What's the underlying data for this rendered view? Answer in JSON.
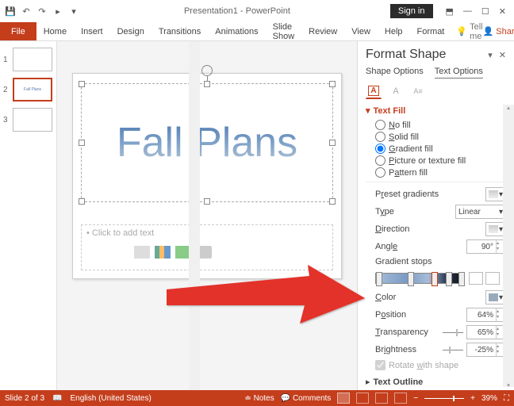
{
  "title": "Presentation1 - PowerPoint",
  "qat": {
    "save": "💾",
    "undo": "↶",
    "redo": "↷",
    "start": "▸"
  },
  "signin": "Sign in",
  "win": {
    "min": "—",
    "max": "☐",
    "close": "✕",
    "ropt": "⬒"
  },
  "tabs": {
    "file": "File",
    "home": "Home",
    "insert": "Insert",
    "design": "Design",
    "transitions": "Transitions",
    "animations": "Animations",
    "slideshow": "Slide Show",
    "review": "Review",
    "view": "View",
    "help": "Help",
    "format": "Format"
  },
  "tellme": "Tell me",
  "share": "Share",
  "thumbs": [
    {
      "n": "1",
      "txt": ""
    },
    {
      "n": "2",
      "txt": "Fall Plans"
    },
    {
      "n": "3",
      "txt": ""
    }
  ],
  "slide": {
    "title": "Fall Plans",
    "content_placeholder": "• Click to add text"
  },
  "panel": {
    "title": "Format Shape",
    "opt_shape": "Shape Options",
    "opt_text": "Text Options",
    "sec_textfill": "Text Fill",
    "fills": {
      "no": "No fill",
      "solid": "Solid fill",
      "gradient": "Gradient fill",
      "picture": "Picture or texture fill",
      "pattern": "Pattern fill"
    },
    "preset": "Preset gradients",
    "type": "Type",
    "type_val": "Linear",
    "direction": "Direction",
    "angle": "Angle",
    "angle_val": "90°",
    "gradstops": "Gradient stops",
    "color": "Color",
    "position": "Position",
    "position_val": "64%",
    "transparency": "Transparency",
    "transparency_val": "65%",
    "brightness": "Brightness",
    "brightness_val": "-25%",
    "rotate": "Rotate with shape",
    "sec_outline": "Text Outline"
  },
  "status": {
    "slide": "Slide 2 of 3",
    "lang": "English (United States)",
    "notes": "Notes",
    "comments": "Comments",
    "zoom": "39%"
  }
}
